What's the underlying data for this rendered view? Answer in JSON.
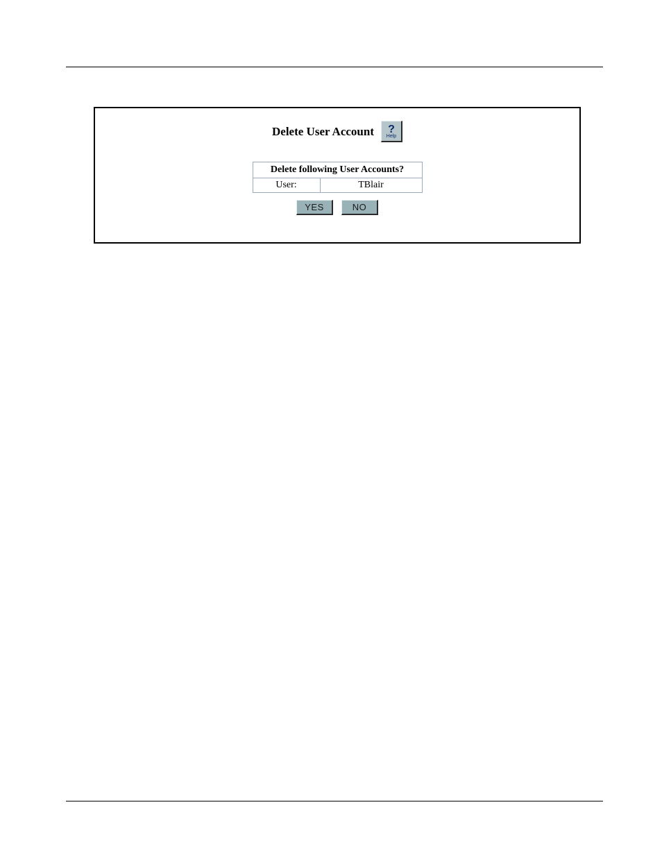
{
  "dialog": {
    "title": "Delete User Account",
    "help_icon_symbol": "?",
    "help_icon_label": "Help",
    "confirm_header": "Delete following User Accounts?",
    "row_label": "User:",
    "row_value": "TBlair",
    "yes_label": "YES",
    "no_label": "NO"
  }
}
